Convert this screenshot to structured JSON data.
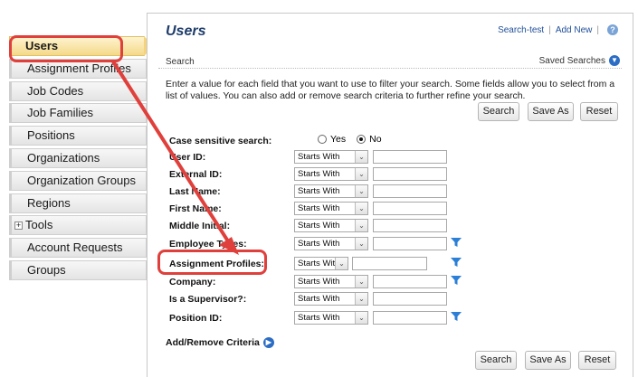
{
  "sidebar": {
    "items": [
      {
        "label": "Users",
        "active": true
      },
      {
        "label": "Assignment Profiles"
      },
      {
        "label": "Job Codes"
      },
      {
        "label": "Job Families"
      },
      {
        "label": "Positions"
      },
      {
        "label": "Organizations"
      },
      {
        "label": "Organization Groups"
      },
      {
        "label": "Regions"
      },
      {
        "label": "Tools",
        "expandable": true
      },
      {
        "label": "Account Requests"
      },
      {
        "label": "Groups"
      }
    ]
  },
  "header": {
    "title": "Users",
    "links": {
      "search_test": "Search-test",
      "separator": "|",
      "add_new": "Add New",
      "help": "?"
    }
  },
  "search": {
    "label": "Search",
    "saved_searches": "Saved Searches",
    "description": "Enter a value for each field that you want to use to filter your search. Some fields allow you to select from a list of values. You can also add or remove search criteria to further refine your search.",
    "buttons": {
      "search": "Search",
      "save_as": "Save As",
      "reset": "Reset"
    }
  },
  "form": {
    "case_sensitive": {
      "label": "Case sensitive search:",
      "yes": "Yes",
      "no": "No",
      "selected": "No"
    },
    "fields": [
      {
        "label": "User ID:",
        "operator": "Starts With",
        "value": ""
      },
      {
        "label": "External ID:",
        "operator": "Starts With",
        "value": ""
      },
      {
        "label": "Last Name:",
        "operator": "Starts With",
        "value": ""
      },
      {
        "label": "First Name:",
        "operator": "Starts With",
        "value": ""
      },
      {
        "label": "Middle Initial:",
        "operator": "Starts With",
        "value": ""
      },
      {
        "label": "Employee Types:",
        "operator": "Starts With",
        "value": "",
        "filter": true
      },
      {
        "label": "Assignment Profiles:",
        "operator": "Starts With",
        "value": "",
        "filter": true
      },
      {
        "label": "Company:",
        "operator": "Starts With",
        "value": "",
        "filter": true
      },
      {
        "label": "Is a Supervisor?:",
        "operator": "Starts With",
        "value": ""
      },
      {
        "label": "Position ID:",
        "operator": "Starts With",
        "value": "",
        "filter": true
      }
    ],
    "add_remove": "Add/Remove Criteria"
  },
  "colors": {
    "accent": "#1f3d6b",
    "annotation": "#e0403c",
    "link": "#1f4f99"
  }
}
